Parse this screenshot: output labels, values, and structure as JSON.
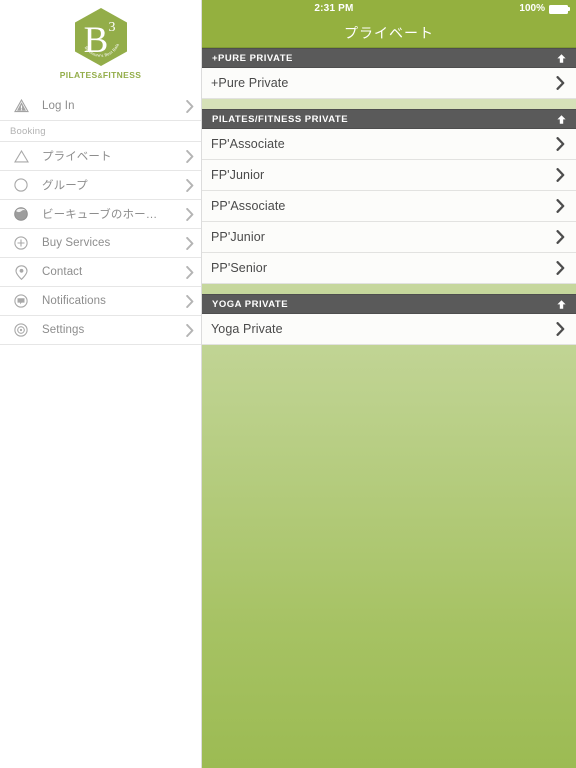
{
  "sidebar": {
    "logo": {
      "mark": "B",
      "superscript": "3",
      "inner_arc_text": "Baltimore's Best Balanced Body",
      "wordmark_left": "PILATES",
      "wordmark_amp": "&",
      "wordmark_right": "FITNESS",
      "brand_green": "#93ad49"
    },
    "items": [
      {
        "label": "Log In",
        "icon": "warning-triangle-icon",
        "chevron": "chevron-right-icon"
      }
    ],
    "section_label": "Booking",
    "booking_items": [
      {
        "label": "プライベート",
        "icon": "triangle-outline-icon",
        "chevron": "chevron-right-icon"
      },
      {
        "label": "グループ",
        "icon": "circle-outline-icon",
        "chevron": "chevron-right-icon"
      },
      {
        "label": "ビーキューブのホー…",
        "icon": "globe-icon",
        "chevron": "chevron-right-icon"
      },
      {
        "label": "Buy Services",
        "icon": "plus-circle-icon",
        "chevron": "chevron-right-icon"
      },
      {
        "label": "Contact",
        "icon": "location-pin-icon",
        "chevron": "chevron-right-icon"
      },
      {
        "label": "Notifications",
        "icon": "chat-bubble-icon",
        "chevron": "chevron-right-icon"
      },
      {
        "label": "Settings",
        "icon": "gear-icon",
        "chevron": "chevron-right-icon"
      }
    ]
  },
  "statusbar": {
    "time": "2:31 PM",
    "battery_percent": "100%",
    "battery_icon": "battery-full-icon",
    "background": "#94b03f"
  },
  "navbar": {
    "title": "プライベート",
    "background": "#94b03f"
  },
  "content": {
    "gradient_top": "#dfe6c8",
    "gradient_bottom": "#9cbb53",
    "section_header_bg": "#5a5a5a",
    "row_bg": "#fcfcfa",
    "sections": [
      {
        "title": "+PURE PRIVATE",
        "collapse_icon": "arrow-up-icon",
        "rows": [
          {
            "label": "+Pure Private",
            "chevron": "chevron-right-icon"
          }
        ]
      },
      {
        "title": "PILATES/FITNESS PRIVATE",
        "collapse_icon": "arrow-up-icon",
        "rows": [
          {
            "label": "FP'Associate",
            "chevron": "chevron-right-icon"
          },
          {
            "label": "FP'Junior",
            "chevron": "chevron-right-icon"
          },
          {
            "label": "PP'Associate",
            "chevron": "chevron-right-icon"
          },
          {
            "label": "PP'Junior",
            "chevron": "chevron-right-icon"
          },
          {
            "label": "PP'Senior",
            "chevron": "chevron-right-icon"
          }
        ]
      },
      {
        "title": "YOGA PRIVATE",
        "collapse_icon": "arrow-up-icon",
        "rows": [
          {
            "label": "Yoga Private",
            "chevron": "chevron-right-icon"
          }
        ]
      }
    ]
  }
}
